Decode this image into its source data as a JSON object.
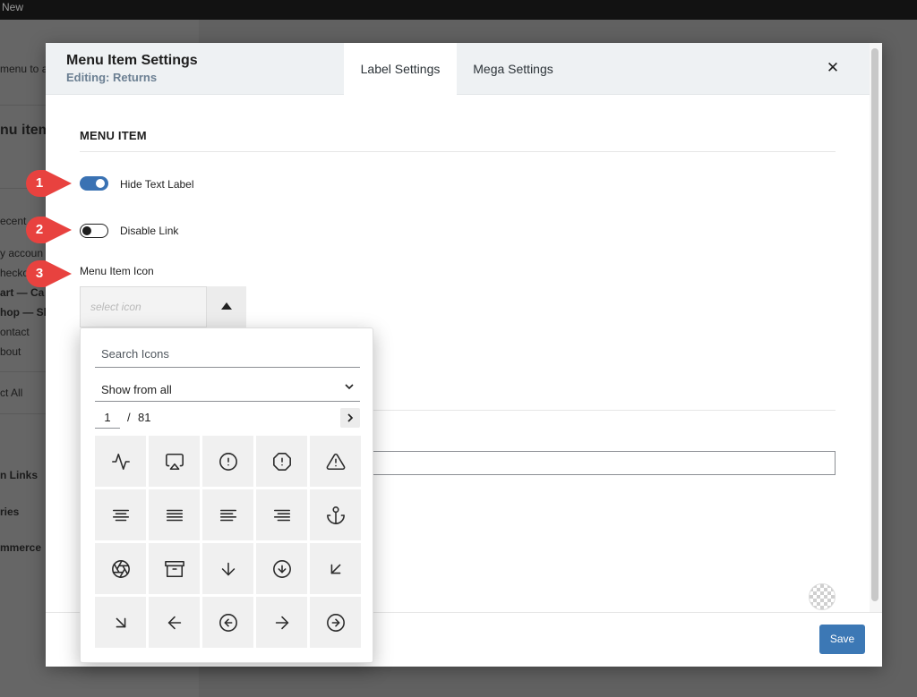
{
  "background": {
    "topbar_new": "New",
    "side_texts": [
      "menu to a",
      "nu item",
      "ecent",
      "y accoun",
      "hecko",
      "art — Ca",
      "hop — Sh",
      "ontact",
      "bout",
      "ct All",
      "n Links",
      "ries",
      "mmerce"
    ]
  },
  "modal": {
    "title": "Menu Item Settings",
    "subtitle": "Editing: Returns",
    "tabs": [
      {
        "label": "Label Settings",
        "active": true
      },
      {
        "label": "Mega Settings",
        "active": false
      }
    ],
    "close_glyph": "✕",
    "section_heading": "MENU ITEM",
    "toggles": [
      {
        "label": "Hide Text Label",
        "on": true
      },
      {
        "label": "Disable Link",
        "on": false
      }
    ],
    "icon_field_label": "Menu Item Icon",
    "icon_select_placeholder": "select icon",
    "save_label": "Save"
  },
  "icon_picker": {
    "search_placeholder": "Search Icons",
    "filter_value": "Show from all",
    "page_current": "1",
    "page_separator": "/",
    "page_total": "81",
    "icons": [
      "activity-icon",
      "airplay-icon",
      "alert-circle-icon",
      "alert-octagon-icon",
      "alert-triangle-icon",
      "align-center-icon",
      "align-justify-icon",
      "align-left-icon",
      "align-right-icon",
      "anchor-icon",
      "aperture-icon",
      "archive-icon",
      "arrow-down-icon",
      "arrow-down-circle-icon",
      "arrow-down-left-icon",
      "arrow-down-right-icon",
      "arrow-left-icon",
      "arrow-left-circle-icon",
      "arrow-right-icon",
      "arrow-right-circle-icon"
    ]
  },
  "callouts": [
    "1",
    "2",
    "3"
  ],
  "colors": {
    "accent": "#3a72b3",
    "save_button": "#3c78b5",
    "callout": "#e8423f",
    "header_bg": "#eef1f3"
  }
}
